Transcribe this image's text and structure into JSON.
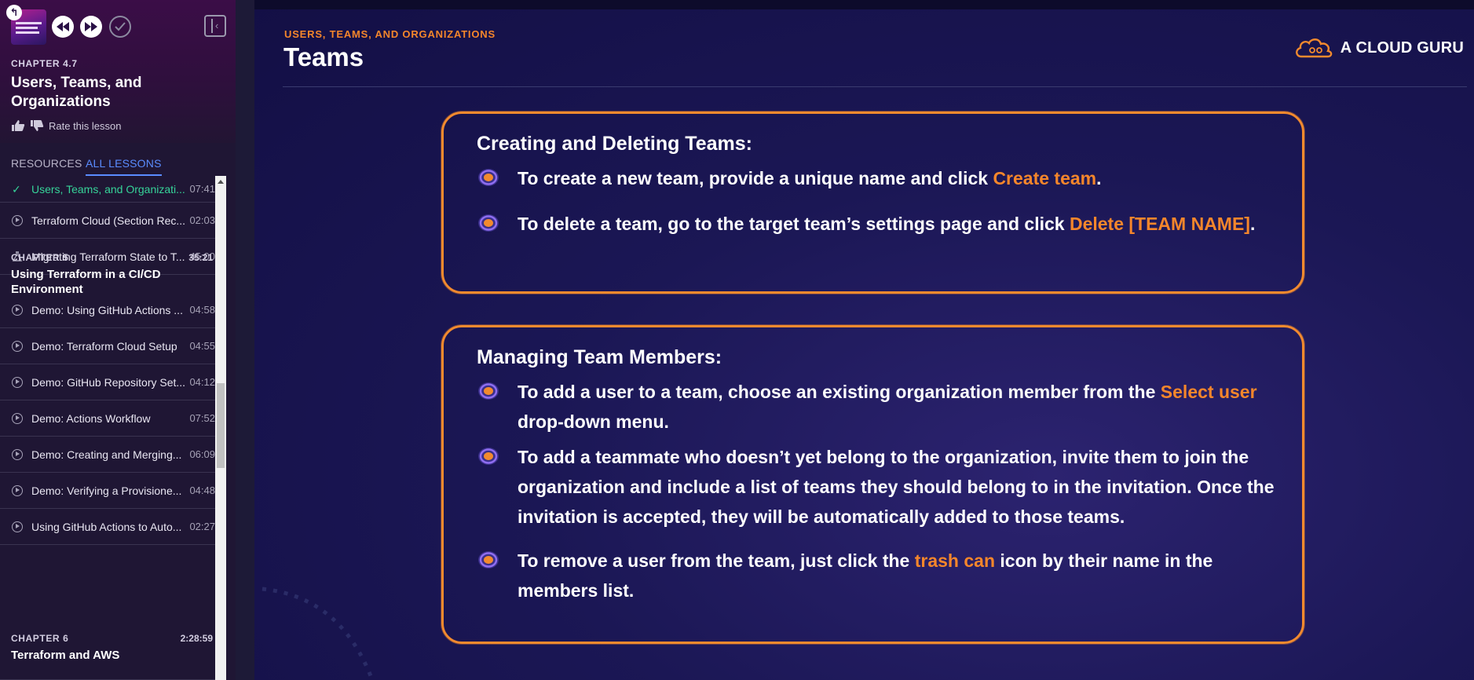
{
  "sidebar": {
    "chapter_kicker": "CHAPTER 4.7",
    "chapter_title": "Users, Teams, and Organizations",
    "rate_label": "Rate this lesson",
    "tabs": [
      {
        "label": "RESOURCES"
      },
      {
        "label": "ALL LESSONS"
      }
    ],
    "lessons_top": [
      {
        "title": "Users, Teams, and Organizati...",
        "duration": "07:41",
        "icon": "check-icon",
        "state": "completed"
      },
      {
        "title": "Terraform Cloud (Section Rec...",
        "duration": "02:03",
        "icon": "play-circle-icon",
        "state": "default"
      },
      {
        "title": "Migrating Terraform State to T...",
        "duration": "45:00",
        "icon": "lab-flask-icon",
        "state": "default"
      }
    ],
    "chapter5": {
      "kicker": "CHAPTER 5",
      "duration": "35:21",
      "title": "Using Terraform in a CI/CD Environment",
      "lessons": [
        {
          "title": "Demo: Using GitHub Actions ...",
          "duration": "04:58"
        },
        {
          "title": "Demo: Terraform Cloud Setup",
          "duration": "04:55"
        },
        {
          "title": "Demo: GitHub Repository Set...",
          "duration": "04:12"
        },
        {
          "title": "Demo: Actions Workflow",
          "duration": "07:52"
        },
        {
          "title": "Demo: Creating and Merging...",
          "duration": "06:09"
        },
        {
          "title": "Demo: Verifying a Provisione...",
          "duration": "04:48"
        },
        {
          "title": "Using GitHub Actions to Auto...",
          "duration": "02:27"
        }
      ]
    },
    "chapter6": {
      "kicker": "CHAPTER 6",
      "duration": "2:28:59",
      "title": "Terraform and AWS"
    }
  },
  "slide": {
    "kicker": "USERS, TEAMS, AND ORGANIZATIONS",
    "title": "Teams",
    "brand": "A CLOUD GURU",
    "accent_color": "#f5862b",
    "card1": {
      "heading": "Creating and Deleting Teams:",
      "items": [
        {
          "pre": "To create a new team, provide a unique name and click ",
          "hl": "Create team",
          "post": "."
        },
        {
          "pre": "To delete a team, go to the target team’s settings page and click ",
          "hl": "Delete [TEAM NAME]",
          "post": "."
        }
      ]
    },
    "card2": {
      "heading": "Managing Team Members:",
      "items": [
        {
          "pre": "To add a user to a team, choose an existing organization member from the ",
          "hl": "Select user",
          "post": " drop-down menu."
        },
        {
          "pre": "To add a teammate who doesn’t yet belong to the organization, invite them to join the organization and include a list of teams they should belong to in the invitation. Once the invitation is accepted, they will be automatically added to those teams.",
          "hl": "",
          "post": ""
        },
        {
          "pre": "To remove a user from the team, just click the ",
          "hl": "trash can",
          "post": " icon by their name in the members list."
        }
      ]
    }
  }
}
